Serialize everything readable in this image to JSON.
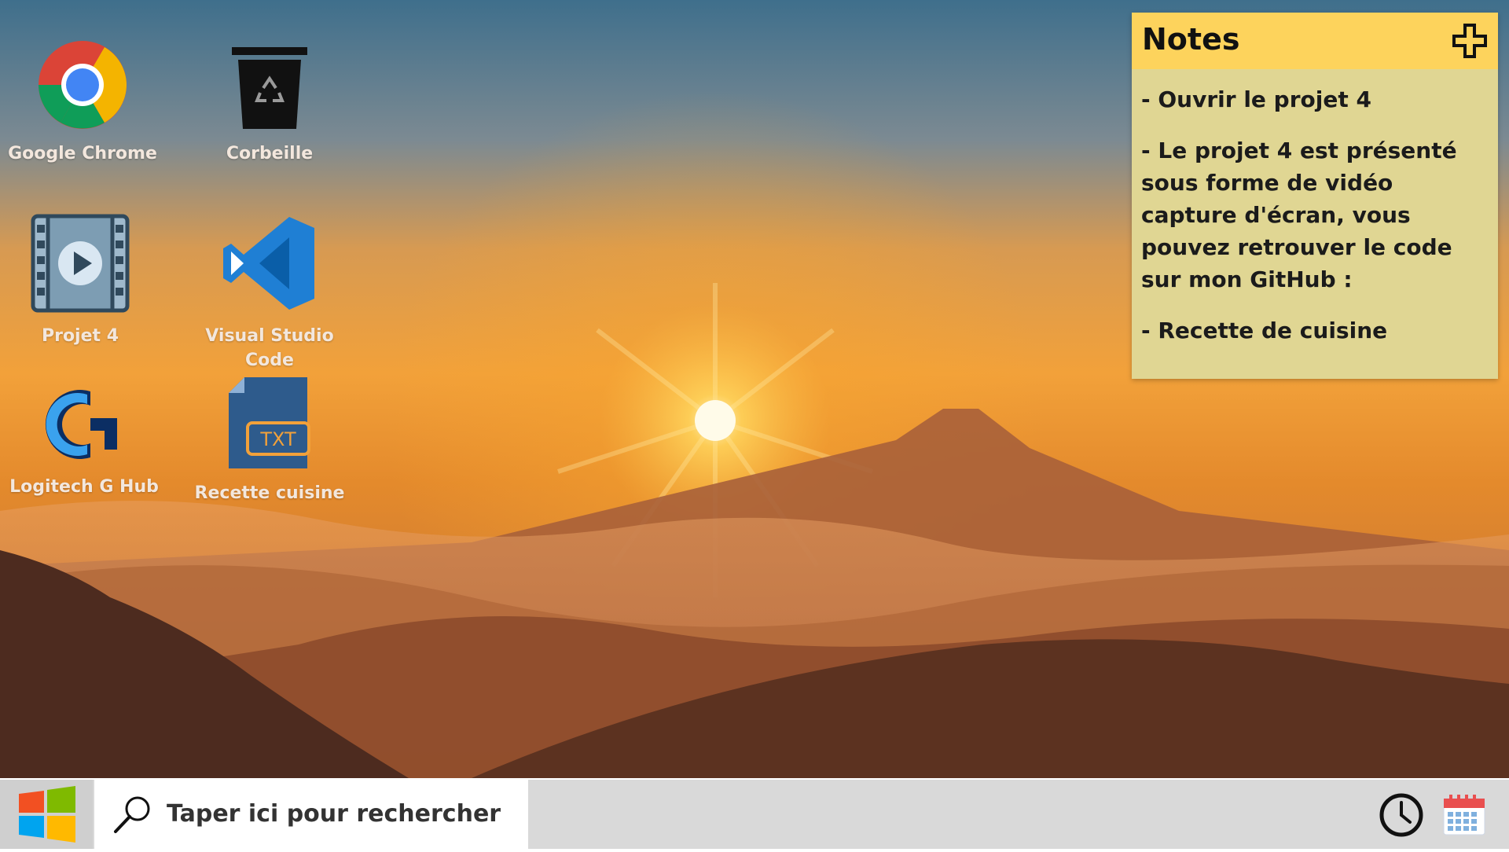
{
  "desktop": {
    "icons": [
      {
        "label": "Google Chrome",
        "icon": "chrome-icon"
      },
      {
        "label": "Corbeille",
        "icon": "recycle-bin-icon"
      },
      {
        "label": "Projet 4",
        "icon": "video-file-icon"
      },
      {
        "label": "Visual Studio Code",
        "icon": "vscode-icon"
      },
      {
        "label": "Logitech G Hub",
        "icon": "logitech-ghub-icon"
      },
      {
        "label": "Recette cuisine",
        "icon": "txt-file-icon",
        "badge": "TXT"
      }
    ]
  },
  "notes": {
    "title": "Notes",
    "add_icon": "plus-icon",
    "items": [
      "- Ouvrir le projet 4",
      "- Le projet 4 est présenté sous forme de vidéo capture d'écran, vous pouvez retrouver le code sur mon GitHub :",
      "- Recette de cuisine"
    ]
  },
  "taskbar": {
    "start_icon": "windows-logo-icon",
    "search_icon": "search-icon",
    "search_placeholder": "Taper ici pour rechercher",
    "tray": [
      "clock-icon",
      "calendar-icon"
    ]
  },
  "colors": {
    "notes_header": "#fdd35c",
    "notes_body": "#e0d693",
    "taskbar": "#d9d9d9",
    "search_box": "#ffffff",
    "icon_label": "#f3e7dd"
  }
}
